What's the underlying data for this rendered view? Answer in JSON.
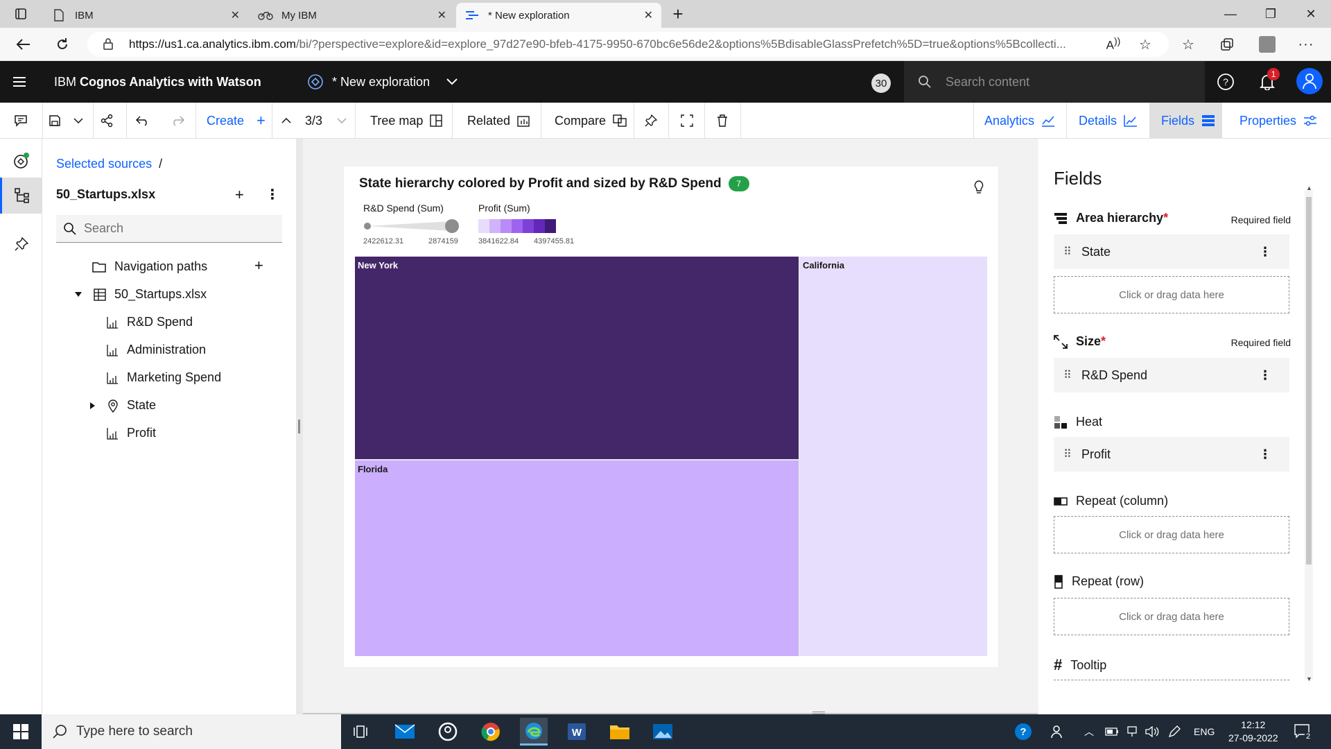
{
  "browser": {
    "tabs": [
      {
        "label": "IBM"
      },
      {
        "label": "My IBM"
      },
      {
        "label": "* New exploration"
      }
    ],
    "url_host": "https://us1.ca.analytics.ibm.com",
    "url_rest": "/bi/?perspective=explore&id=explore_97d27e90-bfeb-4175-9950-670bc6e56de2&options%5BdisableGlassPrefetch%5D=true&options%5Bcollecti..."
  },
  "header": {
    "brand_prefix": "IBM ",
    "brand_bold": "Cognos Analytics with Watson",
    "exploration_name": "* New exploration",
    "counter": "30",
    "search_placeholder": "Search content",
    "notification_count": "1"
  },
  "toolbar": {
    "create": "Create",
    "page_indicator": "3/3",
    "tree_map": "Tree map",
    "related": "Related",
    "compare": "Compare",
    "analytics": "Analytics",
    "details": "Details",
    "fields": "Fields",
    "properties": "Properties"
  },
  "sources": {
    "breadcrumb": "Selected sources",
    "breadcrumb_sep": "/",
    "source_name": "50_Startups.xlsx",
    "search_placeholder": "Search",
    "tree": [
      {
        "label": "Navigation paths"
      },
      {
        "label": "50_Startups.xlsx"
      },
      {
        "label": "R&D Spend"
      },
      {
        "label": "Administration"
      },
      {
        "label": "Marketing Spend"
      },
      {
        "label": "State"
      },
      {
        "label": "Profit"
      }
    ]
  },
  "viz": {
    "title": "State hierarchy colored by Profit and sized by R&D Spend",
    "badge": "7",
    "size_legend_title": "R&D Spend (Sum)",
    "size_min": "2422612.31",
    "size_max": "2874159",
    "color_legend_title": "Profit (Sum)",
    "color_min": "3841622.84",
    "color_max": "4397455.81",
    "color_steps": [
      "#e8dcfd",
      "#d0b3fc",
      "#b98bf7",
      "#9d64ef",
      "#7f40d9",
      "#6228b8",
      "#3f1a7a"
    ]
  },
  "chart_data": {
    "type": "treemap",
    "title": "State hierarchy colored by Profit and sized by R&D Spend",
    "size_measure": "R&D Spend (Sum)",
    "color_measure": "Profit (Sum)",
    "nodes": [
      {
        "label": "New York",
        "color": "#442768"
      },
      {
        "label": "Florida",
        "color": "#cbaefd"
      },
      {
        "label": "California",
        "color": "#e7defd"
      }
    ],
    "size_range": [
      2422612.31,
      2874159
    ],
    "color_range": [
      3841622.84,
      4397455.81
    ]
  },
  "fields": {
    "title": "Fields",
    "area_hierarchy": "Area hierarchy",
    "area_item": "State",
    "size": "Size",
    "size_item": "R&D Spend",
    "required": "Required field",
    "required_mark": "*",
    "heat": "Heat",
    "heat_item": "Profit",
    "repeat_column": "Repeat (column)",
    "repeat_row": "Repeat (row)",
    "tooltip": "Tooltip",
    "drop_placeholder": "Click or drag data here"
  },
  "taskbar": {
    "search_placeholder": "Type here to search",
    "language": "ENG",
    "time": "12:12",
    "date": "27-09-2022",
    "notifications": "2"
  }
}
